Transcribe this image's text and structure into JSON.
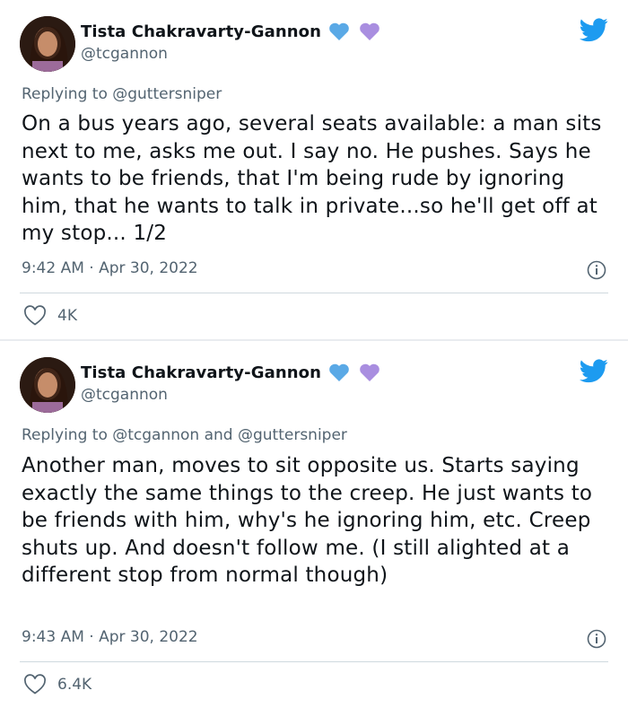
{
  "tweets": [
    {
      "author": "Tista Chakravarty-Gannon",
      "handle": "@tcgannon",
      "replying_to": "Replying to @guttersniper",
      "text": "On a bus years ago, several seats available: a man sits next to me, asks me out. I say no. He pushes. Says he wants to be friends, that I'm being rude by ignoring him, that he wants to talk in private...so he'll get off at my stop... 1/2",
      "timestamp": "9:42 AM · Apr 30, 2022",
      "likes": "4K"
    },
    {
      "author": "Tista Chakravarty-Gannon",
      "handle": "@tcgannon",
      "replying_to": "Replying to @tcgannon and @guttersniper",
      "text": "Another man, moves to sit opposite us. Starts saying exactly the same things to the creep. He just wants to be friends with him, why's he ignoring him, etc. Creep shuts up. And doesn't follow me. (I still alighted at a different stop from normal though)",
      "timestamp": "9:43 AM · Apr 30, 2022",
      "likes": "6.4K"
    }
  ],
  "colors": {
    "twitter_blue": "#1d9bf0",
    "blue_heart": "#5aa9e6",
    "purple_heart": "#a98ee0",
    "secondary_text": "#536471"
  },
  "icons": [
    "twitter-bird-icon",
    "blue-heart-icon",
    "purple-heart-icon",
    "info-icon",
    "like-heart-icon"
  ]
}
